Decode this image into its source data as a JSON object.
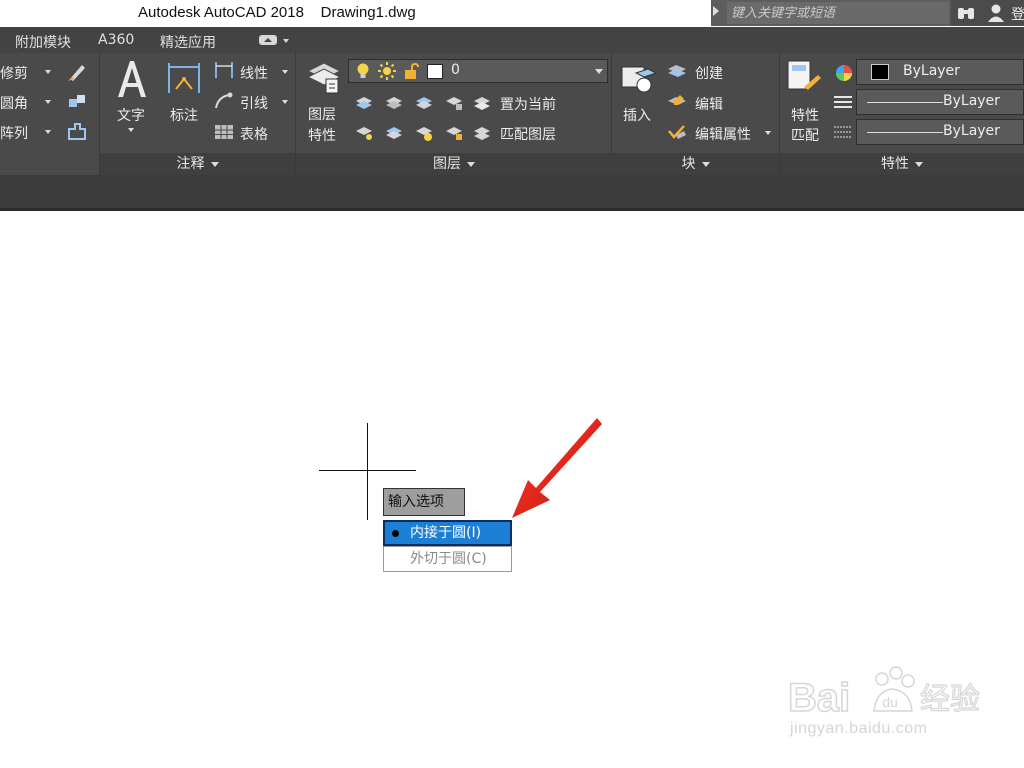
{
  "titlebar": {
    "app_title": "Autodesk AutoCAD 2018",
    "document": "Drawing1.dwg",
    "search_placeholder": "键入关键字或短语",
    "login_partial": "登"
  },
  "tabs": [
    {
      "label": "附加模块"
    },
    {
      "label": "A360"
    },
    {
      "label": "精选应用"
    }
  ],
  "ribbon": {
    "modify": {
      "items": [
        "修剪",
        "圆角",
        "阵列"
      ]
    },
    "annotation": {
      "text_label": "文字",
      "dimension_label": "标注",
      "linear_label": "线性",
      "leader_label": "引线",
      "table_label": "表格",
      "footer": "注释"
    },
    "layers": {
      "layer_props_label_1": "图层",
      "layer_props_label_2": "特性",
      "current_layer": "0",
      "set_current_label": "置为当前",
      "match_layer_label": "匹配图层",
      "footer": "图层"
    },
    "block": {
      "insert_label": "插入",
      "create_label": "创建",
      "edit_label": "编辑",
      "edit_attr_label": "编辑属性",
      "footer": "块"
    },
    "properties": {
      "match_label_1": "特性",
      "match_label_2": "匹配",
      "color_value": "ByLayer",
      "linetype_value": "ByLayer",
      "lineweight_value": "ByLayer",
      "footer": "特性"
    }
  },
  "canvas": {
    "prompt": "输入选项",
    "options": [
      {
        "label": "内接于圆(I)",
        "selected": true
      },
      {
        "label": "外切于圆(C)",
        "selected": false
      }
    ]
  },
  "watermark": {
    "text": "jingyan.baidu.com"
  },
  "colors": {
    "ribbon_bg": "#4a4a4a",
    "selected_option": "#1b7fd6",
    "arrow": "#e8201a"
  }
}
